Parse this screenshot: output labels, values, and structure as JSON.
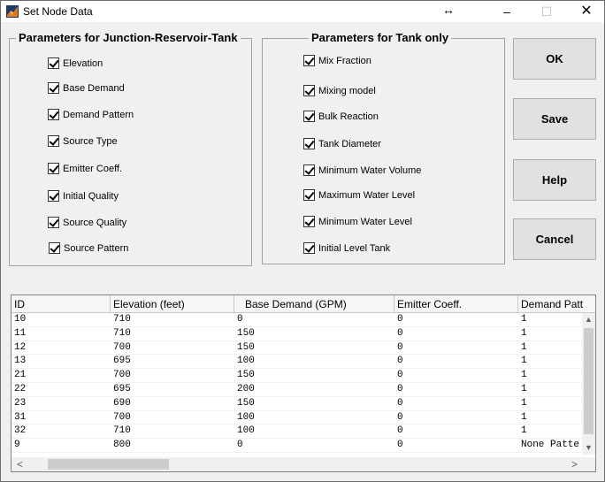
{
  "window": {
    "title": "Set Node Data",
    "resize_glyph": "↔",
    "minimize": "–",
    "maximize": "☐",
    "close": "✕"
  },
  "panel_junction": {
    "title": "Parameters for Junction-Reservoir-Tank",
    "items": [
      "Elevation",
      "Base Demand",
      "Demand Pattern",
      "Source Type",
      "Emitter Coeff.",
      "Initial Quality",
      "Source Quality",
      "Source Pattern"
    ]
  },
  "panel_tank": {
    "title": "Parameters for Tank only",
    "items": [
      "Mix Fraction",
      "Mixing model",
      "Bulk Reaction",
      "Tank Diameter",
      "Minimum Water Volume",
      "Maximum Water Level",
      "Minimum Water Level",
      "Initial Level Tank"
    ]
  },
  "buttons": {
    "ok": "OK",
    "save": "Save",
    "help": "Help",
    "cancel": "Cancel"
  },
  "table": {
    "headers": [
      "ID",
      "Elevation (feet)",
      "Base Demand (GPM)",
      "Emitter Coeff.",
      "Demand Patt"
    ],
    "rows": [
      [
        "10",
        "710",
        "0",
        "0",
        "1"
      ],
      [
        "11",
        "710",
        "150",
        "0",
        "1"
      ],
      [
        "12",
        "700",
        "150",
        "0",
        "1"
      ],
      [
        "13",
        "695",
        "100",
        "0",
        "1"
      ],
      [
        "21",
        "700",
        "150",
        "0",
        "1"
      ],
      [
        "22",
        "695",
        "200",
        "0",
        "1"
      ],
      [
        "23",
        "690",
        "150",
        "0",
        "1"
      ],
      [
        "31",
        "700",
        "100",
        "0",
        "1"
      ],
      [
        "32",
        "710",
        "100",
        "0",
        "1"
      ],
      [
        "9",
        "800",
        "0",
        "0",
        "None Patte"
      ]
    ]
  },
  "scroll": {
    "up": "▲",
    "down": "▼",
    "left": "<",
    "right": ">"
  },
  "colors": {
    "accent_icon": "#d2691e",
    "window_bg": "#f0f0f0",
    "button_bg": "#e1e1e1"
  }
}
